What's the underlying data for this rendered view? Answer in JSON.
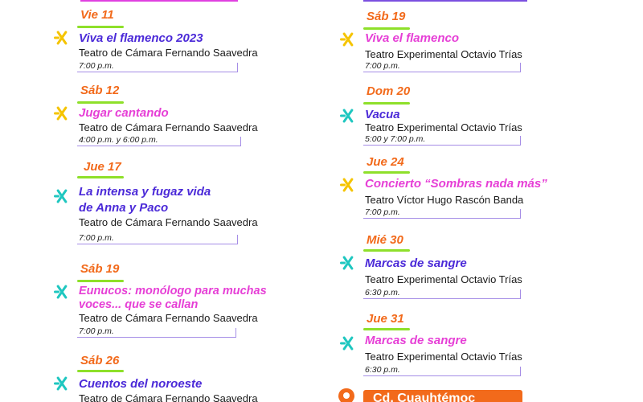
{
  "left": [
    {
      "date": "Vie 11",
      "title": [
        "Viva el flamenco 2023"
      ],
      "venue": "Teatro de Cámara Fernando Saavedra",
      "time": "7:00 p.m.",
      "color": "blue"
    },
    {
      "date": "Sáb 12",
      "title": [
        "Jugar cantando"
      ],
      "venue": "Teatro de Cámara Fernando Saavedra",
      "time": "4:00 p.m. y 6:00 p.m.",
      "color": "pink"
    },
    {
      "date": "Jue 17",
      "title": [
        "La intensa y fugaz vida",
        "de Anna y Paco"
      ],
      "venue": "Teatro de Cámara Fernando Saavedra",
      "time": "7:00 p.m.",
      "color": "blue"
    },
    {
      "date": "Sáb 19",
      "title": [
        "Eunucos: monólogo para muchas",
        "voces... que se callan"
      ],
      "venue": "Teatro de Cámara Fernando Saavedra",
      "time": "7:00 p.m.",
      "color": "pink"
    },
    {
      "date": "Sáb 26",
      "title": [
        "Cuentos del noroeste"
      ],
      "venue": "Teatro de Cámara Fernando Saavedra",
      "time": "",
      "color": "blue"
    }
  ],
  "right": [
    {
      "date": "Sáb 19",
      "title": [
        "Viva el flamenco"
      ],
      "venue": "Teatro Experimental Octavio Trías",
      "time": "7:00 p.m.",
      "color": "pink"
    },
    {
      "date": "Dom 20",
      "title": [
        "Vacua"
      ],
      "venue": "Teatro Experimental Octavio Trías",
      "time": "5:00 y 7:00 p.m.",
      "color": "blue"
    },
    {
      "date": "Jue 24",
      "title": [
        "Concierto “Sombras nada más”"
      ],
      "venue": "Teatro Víctor Hugo Rascón Banda",
      "time": "7:00 p.m.",
      "color": "pink"
    },
    {
      "date": "Mié 30",
      "title": [
        "Marcas de sangre"
      ],
      "venue": "Teatro Experimental Octavio Trías",
      "time": "6:30 p.m.",
      "color": "blue"
    },
    {
      "date": "Jue 31",
      "title": [
        "Marcas de sangre"
      ],
      "venue": "Teatro Experimental Octavio Trías",
      "time": "6:30 p.m.",
      "color": "pink"
    }
  ],
  "location_label": "Cd. Cuauhtémoc",
  "colors": {
    "orange": "#f26a1b",
    "green": "#8ee02a",
    "blue": "#4b2ad8",
    "pink": "#e63fd6",
    "teal": "#1fc7c0",
    "yellow": "#f5c400"
  }
}
